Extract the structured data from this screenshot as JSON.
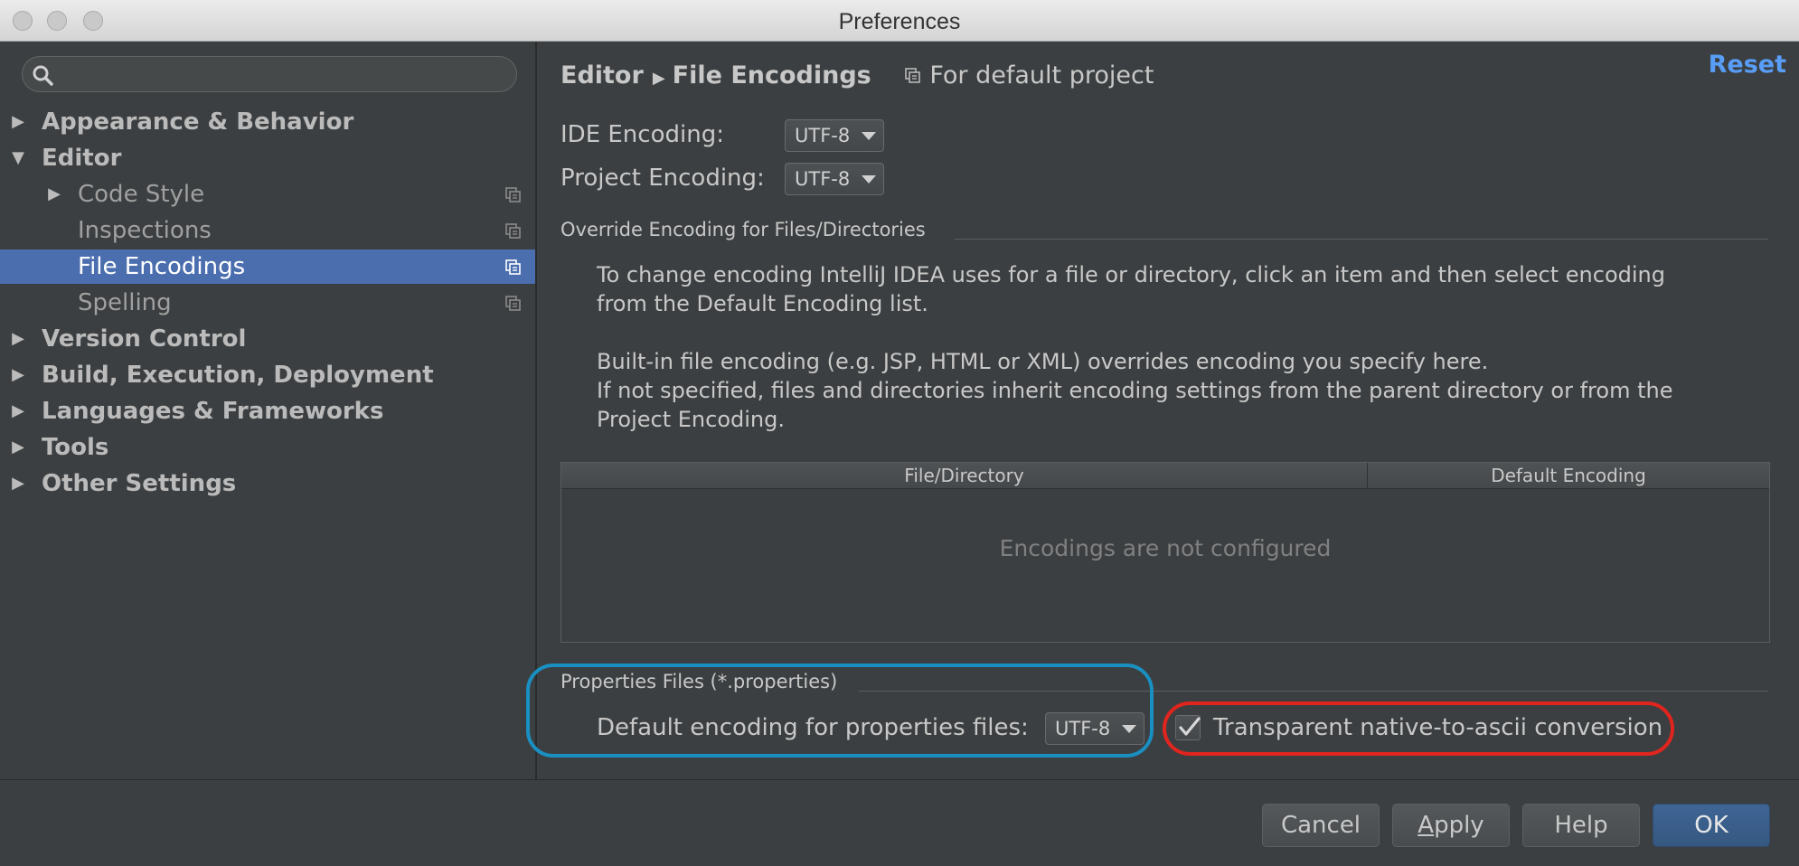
{
  "window": {
    "title": "Preferences"
  },
  "search": {
    "placeholder": "",
    "value": ""
  },
  "sidebar": {
    "items": [
      {
        "label": "Appearance & Behavior"
      },
      {
        "label": "Editor"
      },
      {
        "label": "Code Style"
      },
      {
        "label": "Inspections"
      },
      {
        "label": "File Encodings"
      },
      {
        "label": "Spelling"
      },
      {
        "label": "Version Control"
      },
      {
        "label": "Build, Execution, Deployment"
      },
      {
        "label": "Languages & Frameworks"
      },
      {
        "label": "Tools"
      },
      {
        "label": "Other Settings"
      }
    ],
    "selected": "File Encodings"
  },
  "header": {
    "breadcrumb": [
      "Editor",
      "File Encodings"
    ],
    "scope_label": "For default project",
    "reset_label": "Reset"
  },
  "encoding": {
    "ide_label": "IDE Encoding:",
    "ide_value": "UTF-8",
    "project_label": "Project Encoding:",
    "project_value": "UTF-8"
  },
  "override": {
    "title": "Override Encoding for Files/Directories",
    "info_lines": [
      "To change encoding IntelliJ IDEA uses for a file or directory, click an item and then select encoding",
      "from the Default Encoding list.",
      "Built-in file encoding (e.g. JSP, HTML or XML) overrides encoding you specify here.",
      "If not specified, files and directories inherit encoding settings from the parent directory or from the",
      "Project Encoding."
    ],
    "table": {
      "columns": [
        "File/Directory",
        "Default Encoding"
      ],
      "empty_text": "Encodings are not configured"
    }
  },
  "properties": {
    "title": "Properties Files (*.properties)",
    "default_label": "Default encoding for properties files:",
    "default_value": "UTF-8",
    "native_to_ascii_label": "Transparent native-to-ascii conversion",
    "native_to_ascii_checked": true
  },
  "buttons": {
    "cancel": "Cancel",
    "apply_first": "A",
    "apply_rest": "pply",
    "help": "Help",
    "ok": "OK"
  },
  "colors": {
    "accent": "#4b6eaf",
    "link": "#589df6",
    "highlight_blue": "#1a8fc1",
    "highlight_red": "#e0251f"
  }
}
